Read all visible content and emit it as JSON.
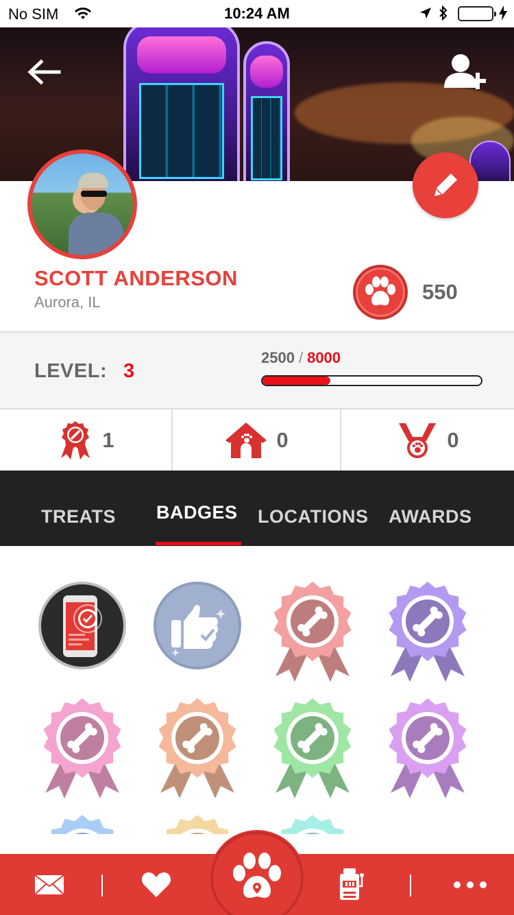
{
  "status_bar": {
    "carrier": "No SIM",
    "time": "10:24 AM"
  },
  "header": {
    "back_icon": "arrow-left-icon",
    "add_friend_icon": "add-user-icon",
    "edit_icon": "pencil-icon"
  },
  "profile": {
    "name": "SCOTT ANDERSON",
    "location": "Aurora, IL",
    "points": "550",
    "points_icon": "paw-icon"
  },
  "level": {
    "label": "LEVEL:",
    "value": "3",
    "xp_current": "2500",
    "xp_separator": "/",
    "xp_max": "8000",
    "progress_fraction": 0.31
  },
  "stats": [
    {
      "icon": "ribbon-badge-icon",
      "value": "1"
    },
    {
      "icon": "dog-house-icon",
      "value": "0"
    },
    {
      "icon": "medal-icon",
      "value": "0"
    }
  ],
  "tabs": [
    {
      "label": "TREATS",
      "active": false
    },
    {
      "label": "BADGES",
      "active": true
    },
    {
      "label": "LOCATIONS",
      "active": false
    },
    {
      "label": "AWARDS",
      "active": false
    }
  ],
  "badges": [
    {
      "icon": "phone-check-icon",
      "color": "#2b2b2b",
      "earned": true
    },
    {
      "icon": "thumbs-up-icon",
      "color": "#a2b0cf",
      "earned": true
    },
    {
      "icon": "bone-ribbon-icon",
      "color": "#f2a0a0",
      "earned": false
    },
    {
      "icon": "bone-ribbon-icon",
      "color": "#b39af0",
      "earned": false
    },
    {
      "icon": "bone-ribbon-icon",
      "color": "#f5a3cf",
      "earned": false
    },
    {
      "icon": "bone-ribbon-icon",
      "color": "#f5b89a",
      "earned": false
    },
    {
      "icon": "bone-ribbon-icon",
      "color": "#9fe6a5",
      "earned": false
    },
    {
      "icon": "bone-ribbon-icon",
      "color": "#d9a0f2",
      "earned": false
    },
    {
      "icon": "bone-ribbon-icon",
      "color": "#a9cdf5",
      "earned": false
    },
    {
      "icon": "bone-ribbon-icon",
      "color": "#f3d9a0",
      "earned": false
    },
    {
      "icon": "bone-ribbon-icon",
      "color": "#a5efe6",
      "earned": false
    }
  ],
  "bottom_nav": {
    "items": [
      {
        "icon": "envelope-icon"
      },
      {
        "icon": "heart-icon"
      },
      {
        "icon": "paw-location-icon"
      },
      {
        "icon": "slot-machine-icon"
      },
      {
        "icon": "more-dots-icon"
      }
    ],
    "accent": "#e03a35"
  },
  "colors": {
    "brand_red": "#e8403b",
    "level_red": "#e8101b",
    "tab_bg": "#222222"
  }
}
